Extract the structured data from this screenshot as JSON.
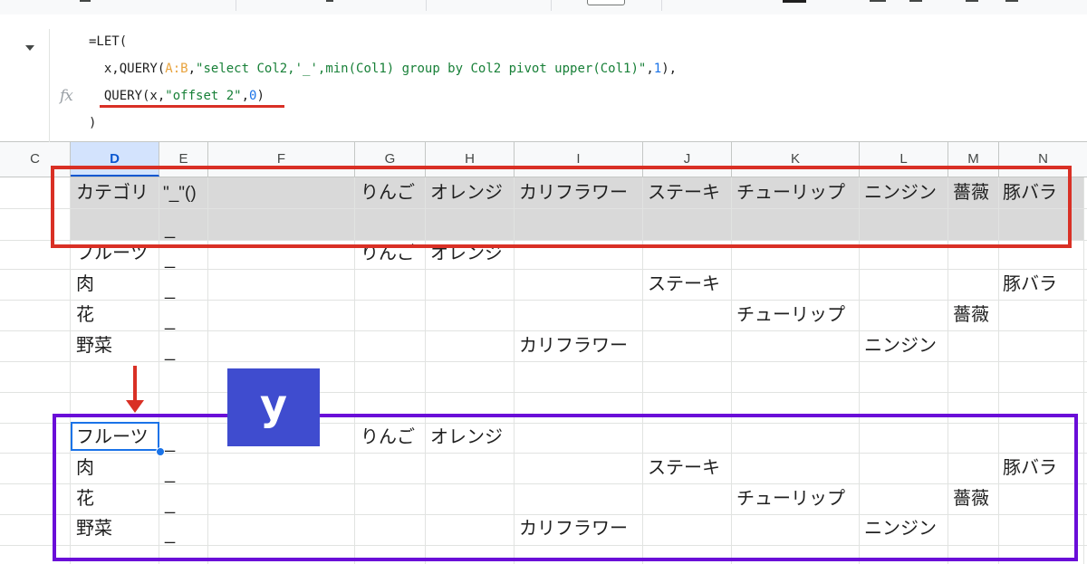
{
  "formula": {
    "line1": "=LET(",
    "line2_a": "  x,QUERY(",
    "line2_range": "A:B",
    "line2_b": ",",
    "line2_str": "\"select Col2,'_',min(Col1) group by Col2 pivot upper(Col1)\"",
    "line2_c": ",",
    "line2_num": "1",
    "line2_d": "),",
    "line3_a": "  QUERY(x,",
    "line3_str": "\"offset 2\"",
    "line3_b": ",",
    "line3_num": "0",
    "line3_c": ")",
    "line4": ")",
    "fx_label": "fx"
  },
  "columns": [
    "C",
    "D",
    "E",
    "F",
    "G",
    "H",
    "I",
    "J",
    "K",
    "L",
    "M",
    "N"
  ],
  "header_row": {
    "d": "カテゴリ",
    "e": "\"_\"()",
    "g": "りんご",
    "h": "オレンジ",
    "i": "カリフラワー",
    "j": "ステーキ",
    "k": "チューリップ",
    "l": "ニンジン",
    "m": "薔薇",
    "n": "豚バラ"
  },
  "header_row2_e": "_",
  "rows_top": [
    {
      "d": "フルーツ",
      "e": "_",
      "g": "りんご",
      "h": "オレンジ"
    },
    {
      "d": "肉",
      "e": "_",
      "j": "ステーキ",
      "n": "豚バラ"
    },
    {
      "d": "花",
      "e": "_",
      "k": "チューリップ",
      "m": "薔薇"
    },
    {
      "d": "野菜",
      "e": "_",
      "i": "カリフラワー",
      "l": "ニンジン"
    }
  ],
  "rows_bottom": [
    {
      "d": "フルーツ",
      "e": "_",
      "g": "りんご",
      "h": "オレンジ"
    },
    {
      "d": "肉",
      "e": "_",
      "j": "ステーキ",
      "n": "豚バラ"
    },
    {
      "d": "花",
      "e": "_",
      "k": "チューリップ",
      "m": "薔薇"
    },
    {
      "d": "野菜",
      "e": "_",
      "i": "カリフラワー",
      "l": "ニンジン"
    }
  ],
  "badge_label": "y",
  "colors": {
    "highlight_red": "#d93025",
    "highlight_purple": "#6a0dd8",
    "badge_blue": "#3f4ccf",
    "selection_blue": "#1a73e8",
    "header_gray": "#d9d9d9"
  }
}
